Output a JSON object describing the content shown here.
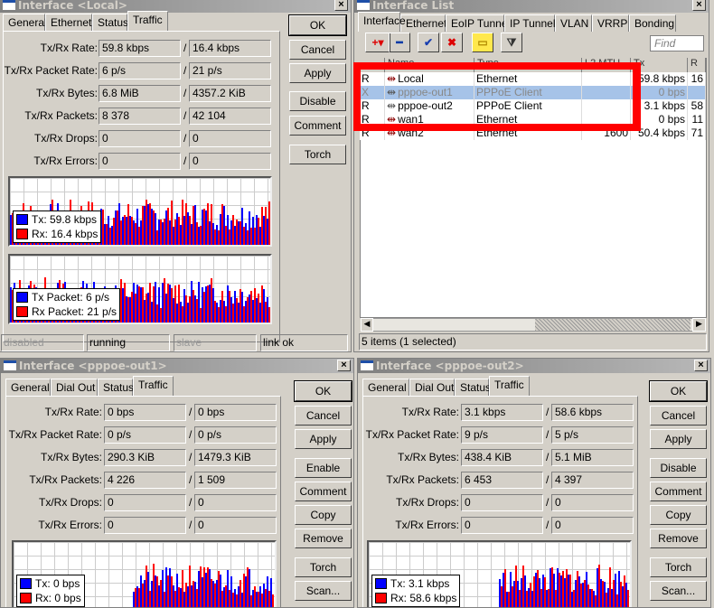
{
  "colors": {
    "tx": "#0000ff",
    "rx": "#ff0000",
    "highlight": "#a6c3e8",
    "annotation": "#ff0000"
  },
  "field_labels": [
    "Tx/Rx Rate:",
    "Tx/Rx Packet Rate:",
    "Tx/Rx Bytes:",
    "Tx/Rx Packets:",
    "Tx/Rx Drops:",
    "Tx/Rx Errors:"
  ],
  "slash": "/",
  "close_label": "×",
  "local": {
    "title": "Interface <Local>",
    "tabs": [
      "General",
      "Ethernet",
      "Status",
      "Traffic"
    ],
    "active_tab": "Traffic",
    "values": [
      [
        "59.8 kbps",
        "16.4 kbps"
      ],
      [
        "6 p/s",
        "21 p/s"
      ],
      [
        "6.8 MiB",
        "4357.2 KiB"
      ],
      [
        "8 378",
        "42 104"
      ],
      [
        "0",
        "0"
      ],
      [
        "0",
        "0"
      ]
    ],
    "buttons": [
      "OK",
      "Cancel",
      "Apply",
      "Disable",
      "Comment",
      "Torch"
    ],
    "legend_rate": [
      "Tx:  59.8 kbps",
      "Rx:  16.4 kbps"
    ],
    "legend_packet": [
      "Tx Packet:  6 p/s",
      "Rx Packet:  21 p/s"
    ],
    "status": [
      "disabled",
      "running",
      "slave",
      "link ok"
    ]
  },
  "interface_list": {
    "title": "Interface List",
    "tabs": [
      "Interface",
      "Ethernet",
      "EoIP Tunnel",
      "IP Tunnel",
      "VLAN",
      "VRRP",
      "Bonding"
    ],
    "active_tab": "Interface",
    "toolbar": [
      "add-icon",
      "remove-icon",
      "enable-icon",
      "disable-icon",
      "comment-icon",
      "filter-icon"
    ],
    "find_placeholder": "Find",
    "columns": [
      "",
      "Name",
      "Type",
      "L2 MTU",
      "Tx",
      "R"
    ],
    "rows": [
      {
        "flag": "R",
        "name": "Local",
        "type": "Ethernet",
        "l2mtu": "",
        "tx": "59.8 kbps",
        "rx": "16",
        "selected": false,
        "disabled": false
      },
      {
        "flag": "X",
        "name": "pppoe-out1",
        "type": "PPPoE Client",
        "l2mtu": "",
        "tx": "0 bps",
        "rx": "",
        "selected": true,
        "disabled": true
      },
      {
        "flag": "R",
        "name": "pppoe-out2",
        "type": "PPPoE Client",
        "l2mtu": "",
        "tx": "3.1 kbps",
        "rx": "58",
        "selected": false,
        "disabled": false
      },
      {
        "flag": "R",
        "name": "wan1",
        "type": "Ethernet",
        "l2mtu": "",
        "tx": "0 bps",
        "rx": "11",
        "selected": false,
        "disabled": false
      },
      {
        "flag": "R",
        "name": "wan2",
        "type": "Ethernet",
        "l2mtu": "1600",
        "tx": "50.4 kbps",
        "rx": "71",
        "selected": false,
        "disabled": false
      }
    ],
    "status": "5 items (1 selected)"
  },
  "pppoe1": {
    "title": "Interface <pppoe-out1>",
    "tabs": [
      "General",
      "Dial Out",
      "Status",
      "Traffic"
    ],
    "active_tab": "Traffic",
    "values": [
      [
        "0 bps",
        "0 bps"
      ],
      [
        "0 p/s",
        "0 p/s"
      ],
      [
        "290.3 KiB",
        "1479.3 KiB"
      ],
      [
        "4 226",
        "1 509"
      ],
      [
        "0",
        "0"
      ],
      [
        "0",
        "0"
      ]
    ],
    "buttons": [
      "OK",
      "Cancel",
      "Apply",
      "Enable",
      "Comment",
      "Copy",
      "Remove",
      "Torch",
      "Scan..."
    ],
    "legend_rate": [
      "Tx:  0 bps",
      "Rx:  0 bps"
    ]
  },
  "pppoe2": {
    "title": "Interface <pppoe-out2>",
    "tabs": [
      "General",
      "Dial Out",
      "Status",
      "Traffic"
    ],
    "active_tab": "Traffic",
    "values": [
      [
        "3.1 kbps",
        "58.6 kbps"
      ],
      [
        "9 p/s",
        "5 p/s"
      ],
      [
        "438.4 KiB",
        "5.1 MiB"
      ],
      [
        "6 453",
        "4 397"
      ],
      [
        "0",
        "0"
      ],
      [
        "0",
        "0"
      ]
    ],
    "buttons": [
      "OK",
      "Cancel",
      "Apply",
      "Disable",
      "Comment",
      "Copy",
      "Remove",
      "Torch",
      "Scan..."
    ],
    "legend_rate": [
      "Tx:  3.1 kbps",
      "Rx:  58.6 kbps"
    ]
  }
}
